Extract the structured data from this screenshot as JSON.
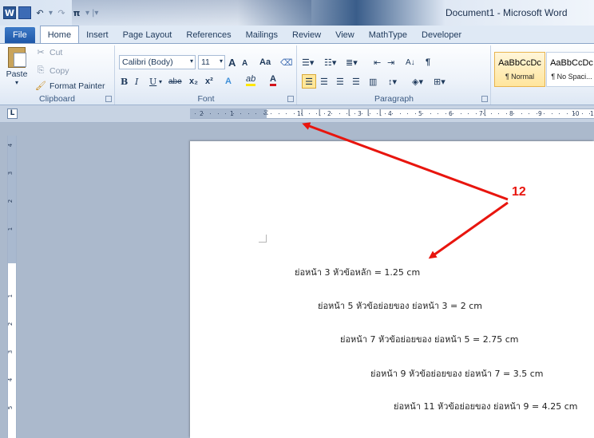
{
  "window": {
    "title": "Document1 - Microsoft Word",
    "quick_access": {
      "logo": "W",
      "undo": "↶",
      "redo": "↷",
      "pi": "π"
    }
  },
  "tabs": [
    {
      "label": "File"
    },
    {
      "label": "Home"
    },
    {
      "label": "Insert"
    },
    {
      "label": "Page Layout"
    },
    {
      "label": "References"
    },
    {
      "label": "Mailings"
    },
    {
      "label": "Review"
    },
    {
      "label": "View"
    },
    {
      "label": "MathType"
    },
    {
      "label": "Developer"
    }
  ],
  "ribbon": {
    "clipboard": {
      "label": "Clipboard",
      "paste": "Paste",
      "cut": "Cut",
      "copy": "Copy",
      "format_painter": "Format Painter"
    },
    "font": {
      "label": "Font",
      "name": "Calibri (Body)",
      "size": "11",
      "grow": "A",
      "shrink": "A",
      "case": "Aa",
      "bold": "B",
      "italic": "I",
      "underline": "U",
      "strike": "abe",
      "subscript": "x₂",
      "superscript": "x²",
      "text_effects": "A",
      "highlight": "ab",
      "font_color": "A"
    },
    "paragraph": {
      "label": "Paragraph",
      "sort": "A↓",
      "pilcrow": "¶"
    },
    "styles": [
      {
        "sample": "AaBbCcDc",
        "name": "¶ Normal"
      },
      {
        "sample": "AaBbCcDc",
        "name": "¶ No Spaci..."
      }
    ]
  },
  "ruler": {
    "tab_selector": "L",
    "numbers": [
      "2",
      "1",
      "1",
      "2",
      "3",
      "4",
      "5",
      "6",
      "7",
      "8",
      "9",
      "10",
      "1"
    ],
    "vertical_numbers": [
      "4",
      "3",
      "2",
      "1",
      "1",
      "2",
      "3",
      "4",
      "5"
    ]
  },
  "document": {
    "lines": [
      "ย่อหน้า 3 หัวข้อหลัก =  1.25 cm",
      "ย่อหน้า 5 หัวข้อย่อยของ ย่อหน้า 3 =  2 cm",
      "ย่อหน้า 7 หัวข้อย่อยของ ย่อหน้า 5 =  2.75 cm",
      "ย่อหน้า 9 หัวข้อย่อยของ ย่อหน้า 7 =  3.5 cm",
      "ย่อหน้า 11 หัวข้อย่อยของ ย่อหน้า 9 = 4.25 cm"
    ]
  },
  "annotation": {
    "number": "12",
    "color": "#e8150e"
  }
}
